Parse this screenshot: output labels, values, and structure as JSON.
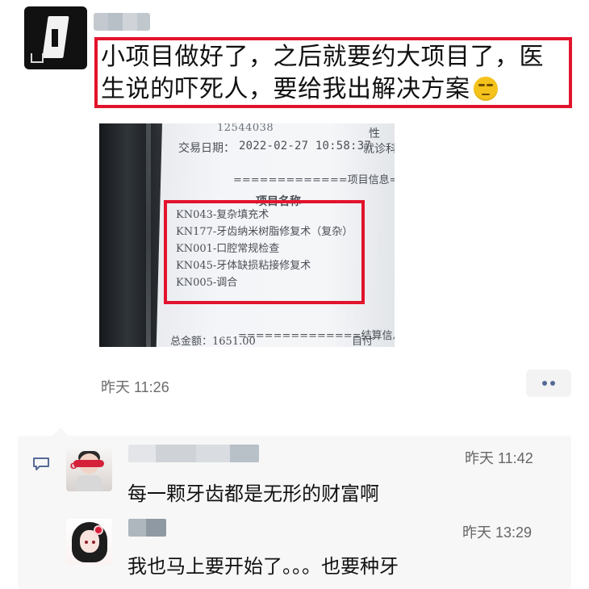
{
  "post": {
    "text": "小项目做好了，之后就要约大项目了，医生说的吓死人，要给我出解决方案",
    "time": "昨天 11:26"
  },
  "receipt": {
    "top_number": "12544038",
    "gender_label": "性",
    "trade_date_label": "交易日期：",
    "trade_date_value": "2022-02-27 10:58:37",
    "visit_label": "就诊科",
    "section_project": "=============项目信息=",
    "project_name_header": "项目名称",
    "items": [
      "KN043-复杂填充术",
      "KN177-牙齿纳米树脂修复术（复杂）",
      "KN001-口腔常规检查",
      "KN045-牙体缺损粘接修复术",
      "KN005-调合"
    ],
    "section_settlement": "==============结算信息=",
    "bottom_left": "总金额：1651.00",
    "bottom_right": "自付"
  },
  "comments": [
    {
      "time": "昨天 11:42",
      "text": "每一颗牙齿都是无形的财富啊"
    },
    {
      "time": "昨天 13:29",
      "text": "我也马上要开始了。。。也要种牙"
    }
  ],
  "icons": {
    "comment": "comment-icon",
    "more": "more-icon"
  },
  "colors": {
    "highlight": "#e2132c",
    "link_blue": "#556a96",
    "muted_text": "#666666"
  }
}
